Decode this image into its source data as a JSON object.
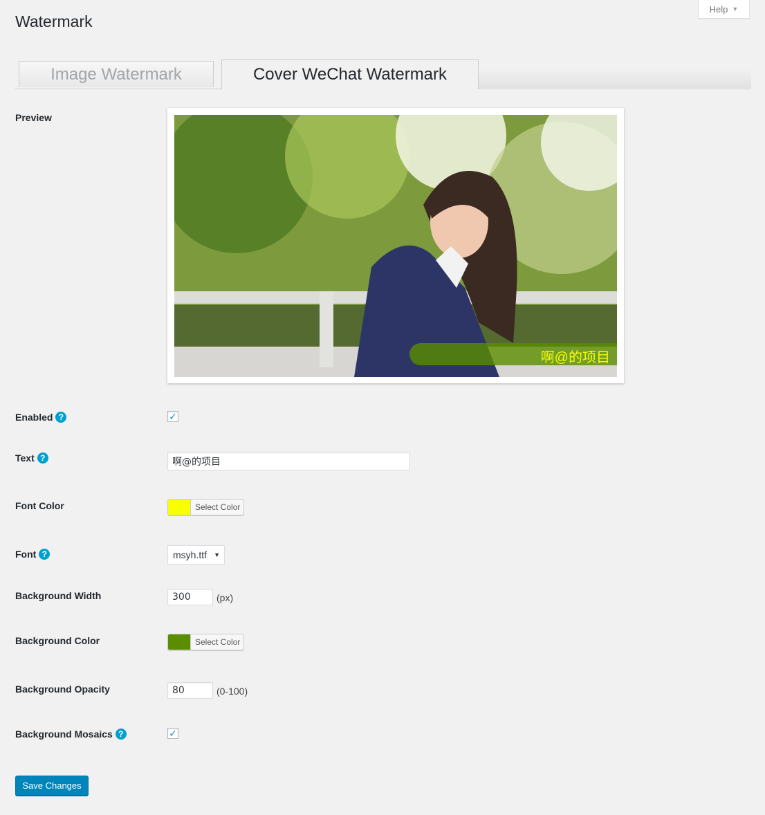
{
  "header": {
    "title": "Watermark",
    "help_label": "Help"
  },
  "tabs": [
    {
      "label": "Image Watermark",
      "active": false
    },
    {
      "label": "Cover WeChat Watermark",
      "active": true
    }
  ],
  "fields": {
    "preview": {
      "label": "Preview",
      "watermark_text": "啊@的项目"
    },
    "enabled": {
      "label": "Enabled",
      "checked": true
    },
    "text": {
      "label": "Text",
      "value": "啊@的项目"
    },
    "font_color": {
      "label": "Font Color",
      "color": "#f7ff00",
      "button_label": "Select Color"
    },
    "font": {
      "label": "Font",
      "selected": "msyh.ttf"
    },
    "background_width": {
      "label": "Background Width",
      "value": "300",
      "unit": "(px)"
    },
    "background_color": {
      "label": "Background Color",
      "color": "#5a8d00",
      "button_label": "Select Color"
    },
    "background_opacity": {
      "label": "Background Opacity",
      "value": "80",
      "unit": "(0-100)"
    },
    "background_mosaics": {
      "label": "Background Mosaics",
      "checked": true
    }
  },
  "actions": {
    "save_label": "Save Changes"
  },
  "theme": {
    "accent": "#0085ba",
    "help_icon": "#00a0d2"
  }
}
